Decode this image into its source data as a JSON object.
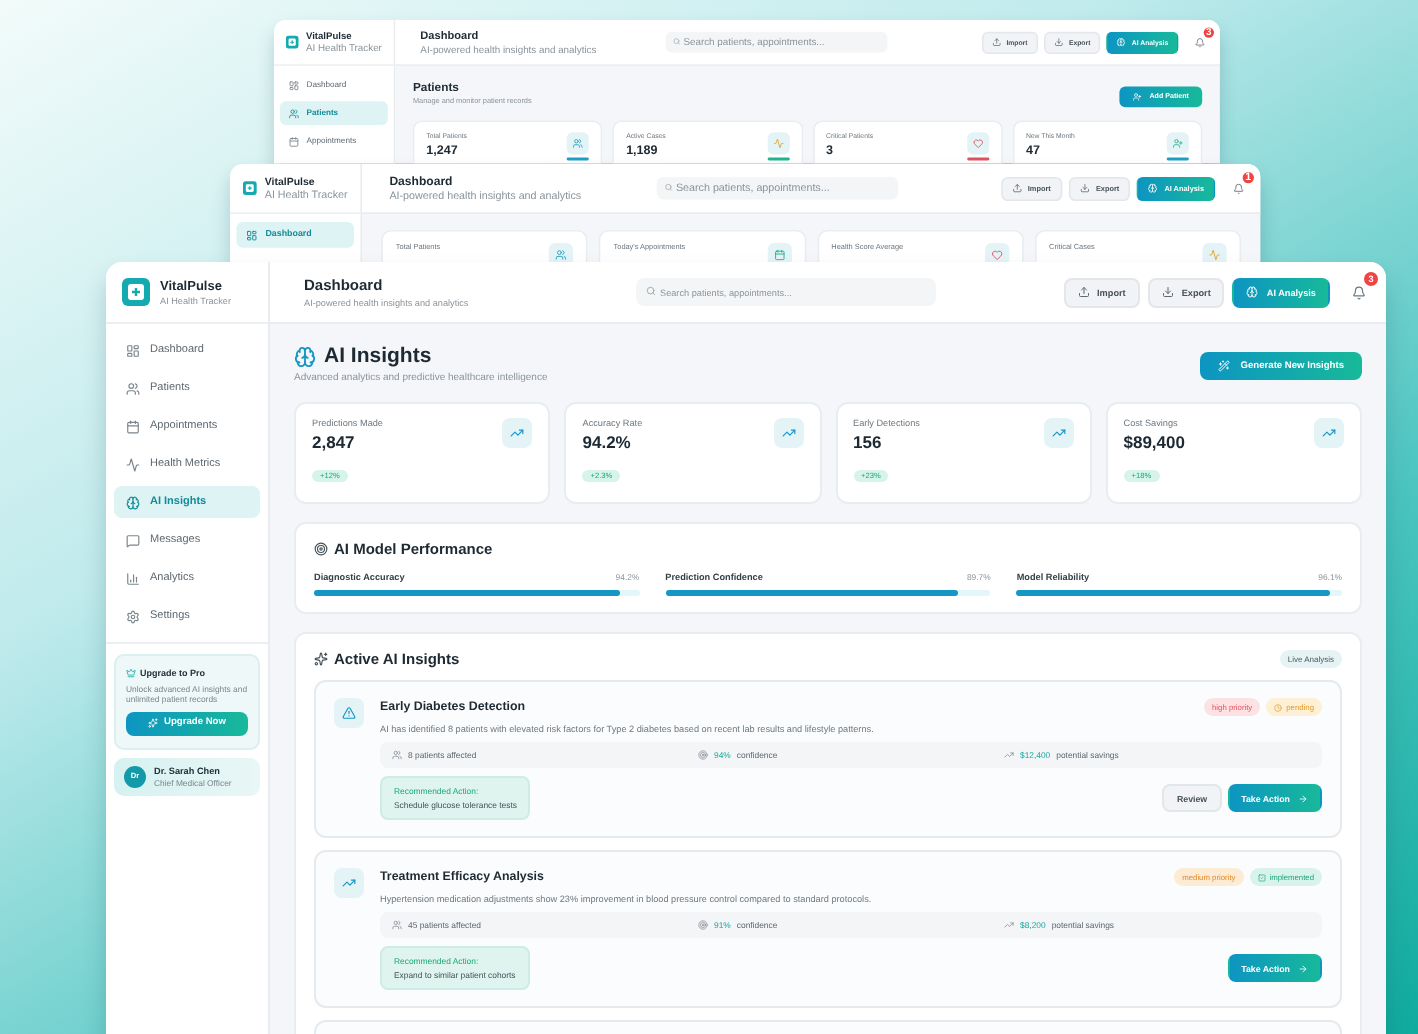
{
  "back_windows": [
    {
      "brand": {
        "name": "VitalPulse",
        "tagline": "AI Health Tracker"
      },
      "nav": [
        {
          "label": "Dashboard",
          "kind": "dashboard",
          "selected": false
        },
        {
          "label": "Patients",
          "kind": "patients",
          "selected": true
        },
        {
          "label": "Appointments",
          "kind": "calendar",
          "selected": false
        }
      ],
      "header": {
        "title": "Dashboard",
        "subtitle": "AI-powered health insights and analytics",
        "search_placeholder": "Search patients, appointments...",
        "buttons": [
          {
            "label": "Import",
            "kind": "import"
          },
          {
            "label": "Export",
            "kind": "export"
          },
          {
            "label": "AI Analysis",
            "kind": "ai"
          }
        ],
        "notifications": "3"
      },
      "page": {
        "title": "Patients",
        "subtitle": "Manage and monitor patient records",
        "action": "Add Patient"
      },
      "stats": [
        {
          "label": "Total Patients",
          "value": "1,247",
          "kind": "users",
          "color": "#1f9fc4"
        },
        {
          "label": "Active Cases",
          "value": "1,189",
          "kind": "activity",
          "color": "#1fb58f"
        },
        {
          "label": "Critical Patients",
          "value": "3",
          "kind": "heart",
          "color": "#e0525f"
        },
        {
          "label": "New This Month",
          "value": "47",
          "kind": "user-plus",
          "color": "#1f9fc4"
        }
      ]
    },
    {
      "brand": {
        "name": "VitalPulse",
        "tagline": "AI Health Tracker"
      },
      "nav": [
        {
          "label": "Dashboard",
          "kind": "dashboard",
          "selected": true
        }
      ],
      "header": {
        "title": "Dashboard",
        "subtitle": "AI-powered health insights and analytics",
        "search_placeholder": "Search patients, appointments...",
        "buttons": [
          {
            "label": "Import",
            "kind": "import"
          },
          {
            "label": "Export",
            "kind": "export"
          },
          {
            "label": "AI Analysis",
            "kind": "ai"
          }
        ],
        "notifications": "1"
      },
      "stats": [
        {
          "label": "Total Patients",
          "kind": "users"
        },
        {
          "label": "Today's Appointments",
          "kind": "calendar"
        },
        {
          "label": "Health Score Average",
          "kind": "heart"
        },
        {
          "label": "Critical Cases",
          "kind": "activity"
        }
      ]
    }
  ],
  "window": {
    "brand": {
      "name": "VitalPulse",
      "tagline": "AI Health Tracker"
    },
    "nav": [
      {
        "label": "Dashboard",
        "kind": "dashboard",
        "selected": false
      },
      {
        "label": "Patients",
        "kind": "patients",
        "selected": false
      },
      {
        "label": "Appointments",
        "kind": "calendar",
        "selected": false
      },
      {
        "label": "Health Metrics",
        "kind": "metrics",
        "selected": false
      },
      {
        "label": "AI Insights",
        "kind": "insights",
        "selected": true
      },
      {
        "label": "Messages",
        "kind": "messages",
        "selected": false
      },
      {
        "label": "Analytics",
        "kind": "analytics",
        "selected": false
      },
      {
        "label": "Settings",
        "kind": "settings",
        "selected": false
      }
    ],
    "upgrade": {
      "title": "Upgrade to Pro",
      "text": "Unlock advanced AI insights and unlimited patient records",
      "button": "Upgrade Now"
    },
    "user": {
      "initials": "Dr",
      "name": "Dr. Sarah Chen",
      "role": "Chief Medical Officer"
    },
    "header": {
      "title": "Dashboard",
      "subtitle": "AI-powered health insights and analytics",
      "search_placeholder": "Search patients, appointments...",
      "buttons": [
        {
          "label": "Import",
          "kind": "import"
        },
        {
          "label": "Export",
          "kind": "export"
        },
        {
          "label": "AI Analysis",
          "kind": "ai"
        }
      ],
      "notifications": "3"
    },
    "page": {
      "title": "AI Insights",
      "subtitle": "Advanced analytics and predictive healthcare intelligence",
      "action": "Generate New Insights"
    },
    "stats": [
      {
        "label": "Predictions Made",
        "value": "2,847",
        "change": "+12%"
      },
      {
        "label": "Accuracy Rate",
        "value": "94.2%",
        "change": "+2.3%"
      },
      {
        "label": "Early Detections",
        "value": "156",
        "change": "+23%"
      },
      {
        "label": "Cost Savings",
        "value": "$89,400",
        "change": "+18%"
      }
    ],
    "performance": {
      "title": "AI Model Performance",
      "metrics": [
        {
          "label": "Diagnostic Accuracy",
          "reading": "94.2%",
          "level": 0.942
        },
        {
          "label": "Prediction Confidence",
          "reading": "89.7%",
          "level": 0.897
        },
        {
          "label": "Model Reliability",
          "reading": "96.1%",
          "level": 0.961
        }
      ]
    },
    "insights": {
      "title": "Active AI Insights",
      "badge": "Live Analysis",
      "items": [
        {
          "kind": "alert",
          "title": "Early Diabetes Detection",
          "description": "AI has identified 8 patients with elevated risk factors for Type 2 diabetes based on recent lab results and lifestyle patterns.",
          "priority": {
            "kind": "high",
            "label": "high priority"
          },
          "status": {
            "kind": "pending",
            "label": "pending"
          },
          "patients": "8 patients affected",
          "confidence": {
            "value": "94%",
            "label": "confidence"
          },
          "savings": {
            "value": "$12,400",
            "label": "potential savings"
          },
          "recommendation": {
            "label": "Recommended Action:",
            "text": "Schedule glucose tolerance tests"
          },
          "actions": [
            {
              "label": "Review",
              "kind": "secondary"
            },
            {
              "label": "Take Action",
              "kind": "primary"
            }
          ]
        },
        {
          "kind": "trend",
          "title": "Treatment Efficacy Analysis",
          "description": "Hypertension medication adjustments show 23% improvement in blood pressure control compared to standard protocols.",
          "priority": {
            "kind": "medium",
            "label": "medium priority"
          },
          "status": {
            "kind": "implemented",
            "label": "implemented"
          },
          "patients": "45 patients affected",
          "confidence": {
            "value": "91%",
            "label": "confidence"
          },
          "savings": {
            "value": "$8,200",
            "label": "potential savings"
          },
          "recommendation": {
            "label": "Recommended Action:",
            "text": "Expand to similar patient cohorts"
          },
          "actions": [
            {
              "label": "Take Action",
              "kind": "primary"
            }
          ]
        },
        {
          "kind": "empty"
        }
      ]
    }
  }
}
